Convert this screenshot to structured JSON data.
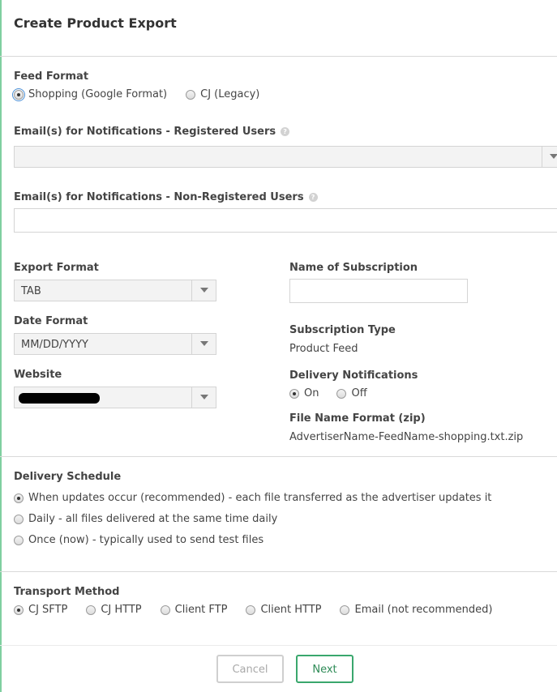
{
  "page": {
    "title": "Create Product Export"
  },
  "feed_format": {
    "label": "Feed Format",
    "options": [
      "Shopping (Google Format)",
      "CJ (Legacy)"
    ],
    "selected": 0
  },
  "emails_registered": {
    "label": "Email(s) for Notifications - Registered Users",
    "help": "?",
    "value": ""
  },
  "emails_nonregistered": {
    "label": "Email(s) for Notifications - Non-Registered Users",
    "help": "?",
    "value": ""
  },
  "export_format": {
    "label": "Export Format",
    "value": "TAB"
  },
  "date_format": {
    "label": "Date Format",
    "value": "MM/DD/YYYY"
  },
  "website": {
    "label": "Website",
    "value": ""
  },
  "subscription_name": {
    "label": "Name of Subscription",
    "value": ""
  },
  "subscription_type": {
    "label": "Subscription Type",
    "value": "Product Feed"
  },
  "delivery_notifications": {
    "label": "Delivery Notifications",
    "options": [
      "On",
      "Off"
    ],
    "selected": 0
  },
  "file_name_format": {
    "label": "File Name Format (zip)",
    "value": "AdvertiserName-FeedName-shopping.txt.zip"
  },
  "delivery_schedule": {
    "label": "Delivery Schedule",
    "options": [
      "When updates occur (recommended) - each file transferred as the advertiser updates it",
      "Daily - all files delivered at the same time daily",
      "Once (now) - typically used to send test files"
    ],
    "selected": 0
  },
  "transport_method": {
    "label": "Transport Method",
    "options": [
      "CJ SFTP",
      "CJ HTTP",
      "Client FTP",
      "Client HTTP",
      "Email (not recommended)"
    ],
    "selected": 0
  },
  "footer": {
    "cancel_label": "Cancel",
    "next_label": "Next"
  },
  "colors": {
    "accent": "#3aa76d",
    "left_border": "#7fcfa0",
    "divider": "#d9d9d9"
  }
}
